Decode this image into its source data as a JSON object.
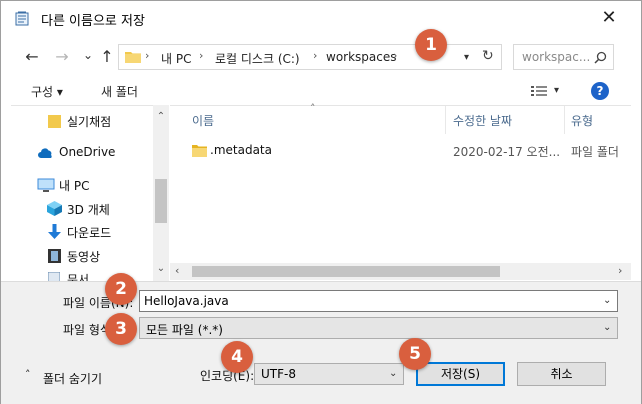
{
  "window": {
    "title": "다른 이름으로 저장",
    "close_glyph": "✕"
  },
  "nav": {
    "back": "←",
    "forward": "→",
    "recent": "⌄",
    "up": "↑",
    "path": [
      "내 PC",
      "로컬 디스크 (C:)",
      "workspaces"
    ],
    "search_placeholder": "workspac..."
  },
  "toolbar": {
    "organize": "구성 ▾",
    "new_folder": "새 폴더",
    "help": "?"
  },
  "sidebar": {
    "items": [
      {
        "label": "실기채점",
        "icon": "folder-icon"
      },
      {
        "label": "OneDrive",
        "icon": "cloud-icon"
      },
      {
        "label": "내 PC",
        "icon": "computer-icon"
      },
      {
        "label": "3D 개체",
        "icon": "cube-icon"
      },
      {
        "label": "다운로드",
        "icon": "download-icon"
      },
      {
        "label": "동영상",
        "icon": "video-icon"
      },
      {
        "label": "문서",
        "icon": "document-icon"
      }
    ]
  },
  "list": {
    "columns": [
      "이름",
      "수정한 날짜",
      "유형"
    ],
    "rows": [
      {
        "name": ".metadata",
        "date": "2020-02-17 오전...",
        "type": "파일 폴더"
      }
    ]
  },
  "form": {
    "filename_label": "파일 이름(N):",
    "filename_value": "HelloJava.java",
    "filetype_label": "파일 형식(T):",
    "filetype_value": "모든 파일 (*.*)",
    "encoding_label": "인코딩(E):",
    "encoding_value": "UTF-8",
    "hide_folders": "폴더 숨기기",
    "save": "저장(S)",
    "cancel": "취소"
  },
  "callouts": [
    "1",
    "2",
    "3",
    "4",
    "5"
  ],
  "colors": {
    "callout": "#d95f3e",
    "accent": "#0078d7",
    "folder": "#f2c94c"
  }
}
